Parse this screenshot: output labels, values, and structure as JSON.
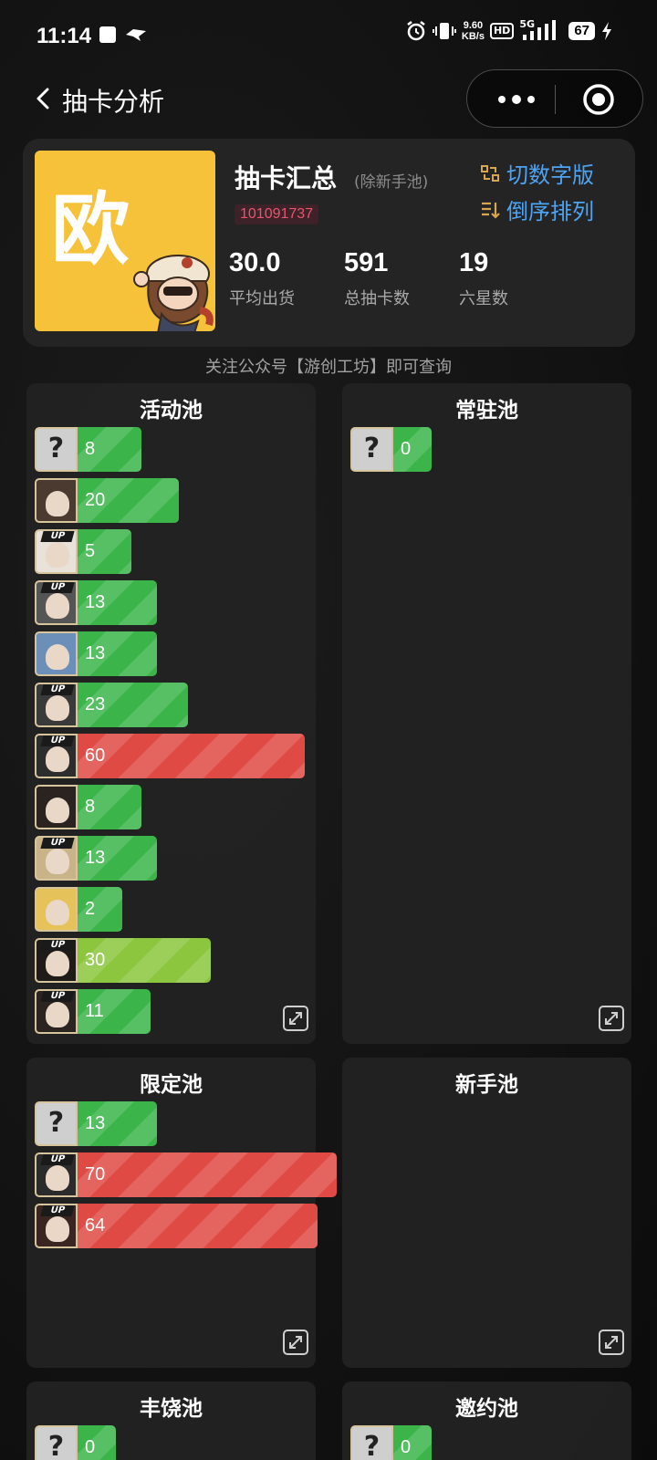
{
  "status": {
    "time": "11:14",
    "speed_top": "9.60",
    "speed_unit": "KB/s",
    "hd": "HD",
    "net": "5G",
    "battery": "67"
  },
  "nav": {
    "title": "抽卡分析"
  },
  "summary": {
    "avatar_char": "欧",
    "title": "抽卡汇总",
    "subtitle": "(除新手池)",
    "uid": "101091737",
    "switch_label": "切数字版",
    "sort_label": "倒序排列",
    "stats": [
      {
        "value": "30.0",
        "label": "平均出货"
      },
      {
        "value": "591",
        "label": "总抽卡数"
      },
      {
        "value": "19",
        "label": "六星数"
      }
    ]
  },
  "notice": "关注公众号【游创工坊】即可查询",
  "pools": [
    {
      "title": "活动池",
      "rows": [
        {
          "value": "8",
          "unknown": true,
          "up": false,
          "color": "green",
          "hair": "#888"
        },
        {
          "value": "20",
          "unknown": false,
          "up": false,
          "color": "green",
          "hair": "#4a3a30"
        },
        {
          "value": "5",
          "unknown": false,
          "up": true,
          "color": "green",
          "hair": "#e8e2d8"
        },
        {
          "value": "13",
          "unknown": false,
          "up": true,
          "color": "green",
          "hair": "#555"
        },
        {
          "value": "13",
          "unknown": false,
          "up": false,
          "color": "green",
          "hair": "#6b8fb8"
        },
        {
          "value": "23",
          "unknown": false,
          "up": true,
          "color": "green",
          "hair": "#3a3a3a"
        },
        {
          "value": "60",
          "unknown": false,
          "up": true,
          "color": "red",
          "hair": "#2d2d2d"
        },
        {
          "value": "8",
          "unknown": false,
          "up": false,
          "color": "green",
          "hair": "#2a2320"
        },
        {
          "value": "13",
          "unknown": false,
          "up": true,
          "color": "green",
          "hair": "#c9b48a"
        },
        {
          "value": "2",
          "unknown": false,
          "up": false,
          "color": "green",
          "hair": "#e6c35a"
        },
        {
          "value": "30",
          "unknown": false,
          "up": true,
          "color": "lime",
          "hair": "#1f1b18"
        },
        {
          "value": "11",
          "unknown": false,
          "up": true,
          "color": "green",
          "hair": "#2b2420"
        }
      ]
    },
    {
      "title": "常驻池",
      "rows": [
        {
          "value": "0",
          "unknown": true,
          "up": false,
          "color": "green",
          "hair": "#888"
        }
      ]
    },
    {
      "title": "限定池",
      "rows": [
        {
          "value": "13",
          "unknown": true,
          "up": false,
          "color": "green",
          "hair": "#888"
        },
        {
          "value": "70",
          "unknown": false,
          "up": true,
          "color": "red",
          "hair": "#2b2b2b"
        },
        {
          "value": "64",
          "unknown": false,
          "up": true,
          "color": "red",
          "hair": "#3a2520"
        }
      ]
    },
    {
      "title": "新手池",
      "rows": []
    },
    {
      "title": "丰饶池",
      "rows": [
        {
          "value": "0",
          "unknown": true,
          "up": false,
          "color": "green",
          "hair": "#888"
        }
      ]
    },
    {
      "title": "邀约池",
      "rows": [
        {
          "value": "0",
          "unknown": true,
          "up": false,
          "color": "green",
          "hair": "#888"
        }
      ]
    }
  ],
  "labels": {
    "unknown_mark": "?",
    "up_tag": "UP"
  }
}
